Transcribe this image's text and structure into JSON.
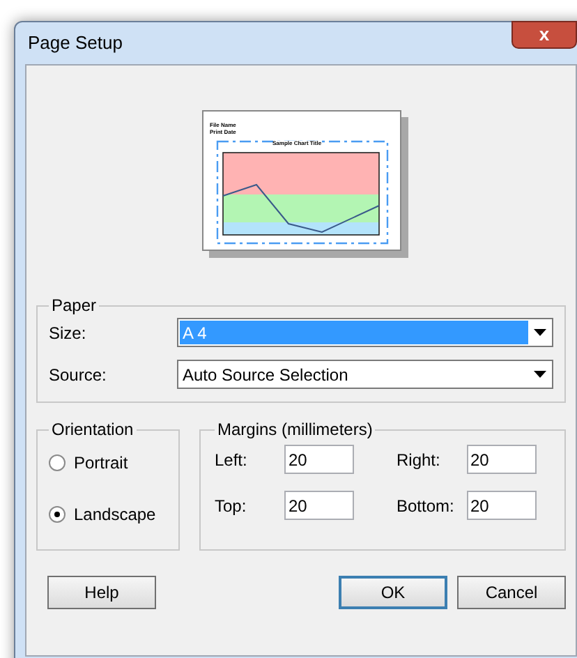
{
  "window": {
    "title": "Page Setup",
    "close": "x"
  },
  "preview": {
    "file_name": "File Name",
    "print_date": "Print Date",
    "chart_title": "Sample Chart Title"
  },
  "paper": {
    "legend": "Paper",
    "fields": [
      {
        "label": "Size:",
        "value": "A 4",
        "selected": true
      },
      {
        "label": "Source:",
        "value": "Auto Source Selection",
        "selected": false
      }
    ]
  },
  "orientation": {
    "legend": "Orientation",
    "options": [
      {
        "label": "Portrait",
        "selected": false
      },
      {
        "label": "Landscape",
        "selected": true
      }
    ]
  },
  "margins": {
    "legend": "Margins (millimeters)",
    "fields": [
      {
        "label": "Left:",
        "value": "20"
      },
      {
        "label": "Right:",
        "value": "20"
      },
      {
        "label": "Top:",
        "value": "20"
      },
      {
        "label": "Bottom:",
        "value": "20"
      }
    ]
  },
  "buttons": [
    {
      "label": "Help",
      "default": false
    },
    {
      "label": "OK",
      "default": true
    },
    {
      "label": "Cancel",
      "default": false
    }
  ]
}
